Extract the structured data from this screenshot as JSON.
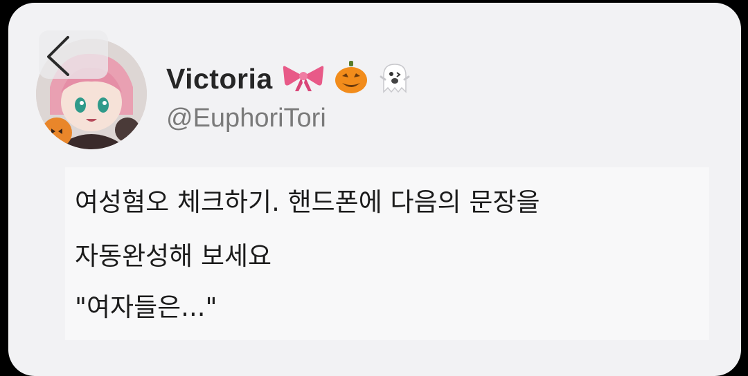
{
  "post": {
    "display_name": "Victoria",
    "name_emojis": [
      "bow-emoji",
      "jack-o-lantern-emoji",
      "ghost-emoji"
    ],
    "handle": "@EuphoriTori",
    "lines": [
      "여성혐오 체크하기. 핸드폰에 다음의 문장을",
      "자동완성해 보세요",
      "\"여자들은...\""
    ]
  },
  "nav": {
    "back_icon": "chevron-left-icon"
  }
}
